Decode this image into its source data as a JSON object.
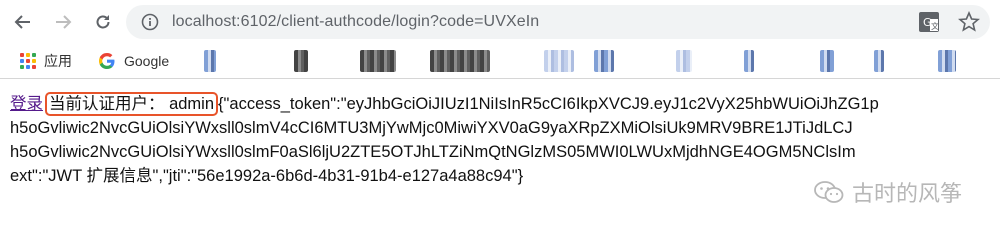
{
  "browser": {
    "url": "localhost:6102/client-authcode/login?code=UVXeIn"
  },
  "bookmarks": {
    "apps_label": "应用",
    "google_label": "Google"
  },
  "page": {
    "login_link": "登录",
    "current_user_label": "当前认证用户： admin",
    "lines": [
      "{\"access_token\":\"eyJhbGciOiJIUzI1NiIsInR5cCI6IkpXVCJ9.eyJ1c2VyX25hbWUiOiJhZG1p",
      "h5oGvliwic2NvcGUiOlsiYWxsll0slmV4cCI6MTU3MjYwMjc0MiwiYXV0aG9yaXRpZXMiOlsiUk9MRV9BRE1JTiJdLCJ",
      "h5oGvliwic2NvcGUiOlsiYWxsll0slmF0aSl6ljU2ZTE5OTJhLTZiNmQtNGlzMS05MWI0LWUxMjdhNGE4OGM5NClsIm",
      "ext\":\"JWT 扩展信息\",\"jti\":\"56e1992a-6b6d-4b31-91b4-e127a4a88c94\"}"
    ]
  },
  "watermark": {
    "text": "古时的风筝"
  }
}
